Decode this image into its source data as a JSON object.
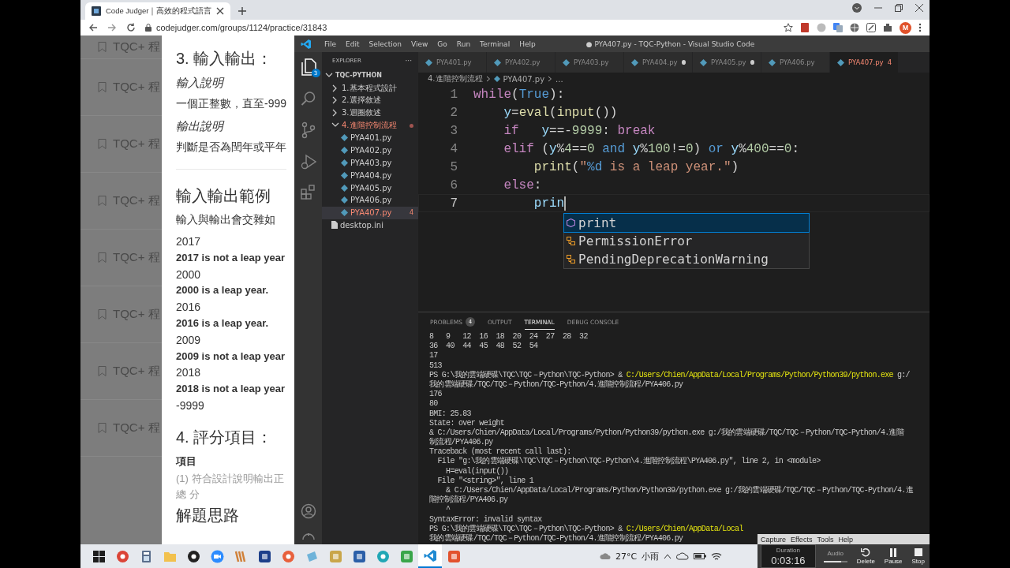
{
  "browser": {
    "tab": {
      "title": "Code Judger｜高效的程式語言"
    },
    "url": "codejudger.com/groups/1124/practice/31843",
    "profile_initial": "M"
  },
  "webpage": {
    "list_items": [
      "TQC+ 程",
      "TQC+ 程",
      "TQC+ 程",
      "TQC+ 程",
      "TQC+ 程",
      "TQC+ 程",
      "TQC+ 程",
      "TQC+ 程"
    ],
    "content": [
      {
        "kind": "heading",
        "text": "3. 輸入輸出："
      },
      {
        "kind": "subheading",
        "text": "輸入說明"
      },
      {
        "kind": "para",
        "text": "一個正整數，直至-999"
      },
      {
        "kind": "subheading",
        "text": "輸出說明"
      },
      {
        "kind": "para",
        "text": "判斷是否為閏年或平年"
      },
      {
        "kind": "divider"
      },
      {
        "kind": "heading",
        "text": "輸入輸出範例"
      },
      {
        "kind": "para",
        "text": "輸入與輸出會交雜如"
      },
      {
        "kind": "input",
        "text": "2017"
      },
      {
        "kind": "output",
        "text": "2017 is not a leap year"
      },
      {
        "kind": "input",
        "text": "2000"
      },
      {
        "kind": "output",
        "text": "2000 is a leap year."
      },
      {
        "kind": "input",
        "text": "2016"
      },
      {
        "kind": "output",
        "text": "2016 is a leap year."
      },
      {
        "kind": "input",
        "text": "2009"
      },
      {
        "kind": "output",
        "text": "2009 is not a leap year"
      },
      {
        "kind": "input",
        "text": "2018"
      },
      {
        "kind": "output",
        "text": "2018 is not a leap year"
      },
      {
        "kind": "input",
        "text": "-9999"
      },
      {
        "kind": "heading",
        "text": "4. 評分項目："
      },
      {
        "kind": "label",
        "text": "項目"
      },
      {
        "kind": "note",
        "text": "(1) 符合設計說明輸出正"
      },
      {
        "kind": "note",
        "text": "總 分"
      },
      {
        "kind": "heading",
        "text": "解題思路"
      }
    ]
  },
  "vscode": {
    "title": "● PYA407.py - TQC-Python - Visual Studio Code",
    "menu": [
      "File",
      "Edit",
      "Selection",
      "View",
      "Go",
      "Run",
      "Terminal",
      "Help"
    ],
    "explorer_badge": "3",
    "explorer_title": "EXPLORER",
    "explorer_more": "···",
    "tree": [
      {
        "label": "TQC-PYTHON",
        "kind": "root",
        "expanded": true,
        "error": false,
        "children": [
          {
            "label": "1.基本程式設計",
            "kind": "folder",
            "expanded": false,
            "error": false
          },
          {
            "label": "2.選擇敘述",
            "kind": "folder",
            "expanded": false,
            "error": false
          },
          {
            "label": "3.迴圈敘述",
            "kind": "folder",
            "expanded": false,
            "error": false
          },
          {
            "label": "4.進階控制流程",
            "kind": "folder",
            "expanded": true,
            "error": true,
            "children": [
              {
                "label": "PYA401.py",
                "kind": "python",
                "selected": false,
                "error": false
              },
              {
                "label": "PYA402.py",
                "kind": "python",
                "selected": false,
                "error": false
              },
              {
                "label": "PYA403.py",
                "kind": "python",
                "selected": false,
                "error": false
              },
              {
                "label": "PYA404.py",
                "kind": "python",
                "selected": false,
                "error": false
              },
              {
                "label": "PYA405.py",
                "kind": "python",
                "selected": false,
                "error": false
              },
              {
                "label": "PYA406.py",
                "kind": "python",
                "selected": false,
                "error": false
              },
              {
                "label": "PYA407.py",
                "kind": "python",
                "selected": true,
                "error": true,
                "problems": "4"
              }
            ]
          },
          {
            "label": "desktop.ini",
            "kind": "file",
            "selected": false,
            "error": false
          }
        ]
      }
    ],
    "tabs": [
      {
        "label": "PYA401.py",
        "selected": false,
        "dirty": false,
        "error": false
      },
      {
        "label": "PYA402.py",
        "selected": false,
        "dirty": false,
        "error": false
      },
      {
        "label": "PYA403.py",
        "selected": false,
        "dirty": false,
        "error": false
      },
      {
        "label": "PYA404.py",
        "selected": false,
        "dirty": true,
        "error": false
      },
      {
        "label": "PYA405.py",
        "selected": false,
        "dirty": true,
        "error": false
      },
      {
        "label": "PYA406.py",
        "selected": false,
        "dirty": false,
        "error": false
      },
      {
        "label": "PYA407.py",
        "selected": true,
        "dirty": true,
        "error": true,
        "problems": "4"
      }
    ],
    "breadcrumb": [
      "4.進階控制流程",
      "PYA407.py",
      "..."
    ],
    "code": [
      {
        "number": "1",
        "cursor": false,
        "tokens": [
          {
            "kind": "kw",
            "text": "while"
          },
          {
            "kind": "p",
            "text": "("
          },
          {
            "kind": "const",
            "text": "True"
          },
          {
            "kind": "p",
            "text": "):"
          }
        ]
      },
      {
        "number": "2",
        "cursor": false,
        "tokens": [
          {
            "kind": "var",
            "text": "    y"
          },
          {
            "kind": "p",
            "text": "="
          },
          {
            "kind": "fn",
            "text": "eval"
          },
          {
            "kind": "p",
            "text": "("
          },
          {
            "kind": "fn",
            "text": "input"
          },
          {
            "kind": "p",
            "text": "())"
          }
        ]
      },
      {
        "number": "3",
        "cursor": false,
        "tokens": [
          {
            "kind": "kw",
            "text": "    if   "
          },
          {
            "kind": "var",
            "text": "y"
          },
          {
            "kind": "p",
            "text": "==-"
          },
          {
            "kind": "num",
            "text": "9999"
          },
          {
            "kind": "p",
            "text": ": "
          },
          {
            "kind": "kw",
            "text": "break"
          }
        ]
      },
      {
        "number": "4",
        "cursor": false,
        "tokens": [
          {
            "kind": "kw",
            "text": "    elif"
          },
          {
            "kind": "p",
            "text": " ("
          },
          {
            "kind": "var",
            "text": "y"
          },
          {
            "kind": "p",
            "text": "%"
          },
          {
            "kind": "num",
            "text": "4"
          },
          {
            "kind": "p",
            "text": "=="
          },
          {
            "kind": "num",
            "text": "0"
          },
          {
            "kind": "const",
            "text": " and "
          },
          {
            "kind": "var",
            "text": "y"
          },
          {
            "kind": "p",
            "text": "%"
          },
          {
            "kind": "num",
            "text": "100"
          },
          {
            "kind": "p",
            "text": "!="
          },
          {
            "kind": "num",
            "text": "0"
          },
          {
            "kind": "p",
            "text": ") "
          },
          {
            "kind": "const",
            "text": "or "
          },
          {
            "kind": "var",
            "text": "y"
          },
          {
            "kind": "p",
            "text": "%"
          },
          {
            "kind": "num",
            "text": "400"
          },
          {
            "kind": "p",
            "text": "=="
          },
          {
            "kind": "num",
            "text": "0"
          },
          {
            "kind": "p",
            "text": ":"
          }
        ]
      },
      {
        "number": "5",
        "cursor": false,
        "tokens": [
          {
            "kind": "fn",
            "text": "        print"
          },
          {
            "kind": "p",
            "text": "("
          },
          {
            "kind": "str",
            "text": "\""
          },
          {
            "kind": "const",
            "text": "%d"
          },
          {
            "kind": "str",
            "text": " is a leap year.\""
          },
          {
            "kind": "p",
            "text": ")"
          }
        ]
      },
      {
        "number": "6",
        "cursor": false,
        "tokens": [
          {
            "kind": "kw",
            "text": "    else"
          },
          {
            "kind": "p",
            "text": ":"
          }
        ]
      },
      {
        "number": "7",
        "cursor": true,
        "tokens": [
          {
            "kind": "var",
            "text": "        prin"
          }
        ]
      }
    ],
    "suggestions": [
      {
        "label": "print",
        "kind": "function",
        "selected": true
      },
      {
        "label": "PermissionError",
        "kind": "class",
        "selected": false
      },
      {
        "label": "PendingDeprecationWarning",
        "kind": "class",
        "selected": false
      }
    ],
    "panel_tabs": [
      {
        "label": "PROBLEMS",
        "count": "4",
        "selected": false
      },
      {
        "label": "OUTPUT",
        "selected": false
      },
      {
        "label": "TERMINAL",
        "selected": true
      },
      {
        "label": "DEBUG CONSOLE",
        "selected": false
      }
    ],
    "terminal": [
      [
        {
          "kind": "plain",
          "text": "8   9   12  16  18  20  24  27  28  32"
        }
      ],
      [
        {
          "kind": "plain",
          "text": "36  40  44  45  48  52  54"
        }
      ],
      [
        {
          "kind": "plain",
          "text": "17"
        }
      ],
      [
        {
          "kind": "plain",
          "text": "513"
        }
      ],
      [
        {
          "kind": "plain",
          "text": "PS G:\\我的雲端硬碟\\TQC\\TQC－Python\\TQC-Python> & "
        },
        {
          "kind": "command",
          "text": "C:/Users/Chien/AppData/Local/Programs/Python/Python39/python.exe"
        },
        {
          "kind": "plain",
          "text": " g:/"
        }
      ],
      [
        {
          "kind": "plain",
          "text": "我的雲端硬碟/TQC/TQC－Python/TQC-Python/4.進階控制流程/PYA406.py"
        }
      ],
      [
        {
          "kind": "plain",
          "text": "176"
        }
      ],
      [
        {
          "kind": "plain",
          "text": "80"
        }
      ],
      [
        {
          "kind": "plain",
          "text": "BMI: 25.83"
        }
      ],
      [
        {
          "kind": "plain",
          "text": "State: over weight"
        }
      ],
      [
        {
          "kind": "plain",
          "text": "& C:/Users/Chien/AppData/Local/Programs/Python/Python39/python.exe g:/我的雲端硬碟/TQC/TQC－Python/TQC-Python/4.進階"
        }
      ],
      [
        {
          "kind": "plain",
          "text": "制流程/PYA406.py"
        }
      ],
      [
        {
          "kind": "plain",
          "text": "Traceback (most recent call last):"
        }
      ],
      [
        {
          "kind": "plain",
          "text": "  File \"g:\\我的雲端硬碟\\TQC\\TQC－Python\\TQC-Python\\4.進階控制流程\\PYA406.py\", line 2, in <module>"
        }
      ],
      [
        {
          "kind": "plain",
          "text": "    H=eval(input())"
        }
      ],
      [
        {
          "kind": "plain",
          "text": "  File \"<string>\", line 1"
        }
      ],
      [
        {
          "kind": "plain",
          "text": "    & C:/Users/Chien/AppData/Local/Programs/Python/Python39/python.exe g:/我的雲端硬碟/TQC/TQC－Python/TQC-Python/4.進"
        }
      ],
      [
        {
          "kind": "plain",
          "text": "階控制流程/PYA406.py"
        }
      ],
      [
        {
          "kind": "plain",
          "text": "    ^"
        }
      ],
      [
        {
          "kind": "plain",
          "text": "SyntaxError: invalid syntax"
        }
      ],
      [
        {
          "kind": "plain",
          "text": "PS G:\\我的雲端硬碟\\TQC\\TQC－Python\\TQC-Python> & "
        },
        {
          "kind": "command",
          "text": "C:/Users/Chien/AppData/Local"
        }
      ],
      [
        {
          "kind": "plain",
          "text": "我的雲端硬碟/TQC/TQC－Python/TQC-Python/4.進階控制流程/PYA406.py"
        }
      ]
    ]
  },
  "taskbar": {
    "apps": [
      {
        "kind": "windows",
        "active": false,
        "color": "#1e1e1e"
      },
      {
        "kind": "ring",
        "active": false,
        "color": "#db4437"
      },
      {
        "kind": "calculator",
        "active": false,
        "color": "#5a6e8c"
      },
      {
        "kind": "folder",
        "active": false,
        "color": "#f2c14e"
      },
      {
        "kind": "ring",
        "active": false,
        "color": "#222222"
      },
      {
        "kind": "camera",
        "active": false,
        "color": "#2d8cff"
      },
      {
        "kind": "stripes",
        "active": false,
        "color": "#d0813a"
      },
      {
        "kind": "square",
        "active": false,
        "color": "#1d3f8a"
      },
      {
        "kind": "ring",
        "active": false,
        "color": "#e8603c"
      },
      {
        "kind": "sheet",
        "active": false,
        "color": "#6fb3d9"
      },
      {
        "kind": "square",
        "active": false,
        "color": "#c9a64a"
      },
      {
        "kind": "square",
        "active": false,
        "color": "#2b5fa8"
      },
      {
        "kind": "ring",
        "active": false,
        "color": "#21a7b5"
      },
      {
        "kind": "square",
        "active": false,
        "color": "#3aa64a"
      },
      {
        "kind": "code",
        "active": true,
        "color": "#1f8ad2"
      },
      {
        "kind": "square",
        "active": false,
        "color": "#e2522e"
      }
    ],
    "weather": "27°C",
    "weather_desc": "小雨"
  },
  "recorder": {
    "menu": [
      "Capture",
      "Effects",
      "Tools",
      "Help"
    ],
    "duration_label": "Duration",
    "duration": "0:03:16",
    "audio": {
      "label": "Audio",
      "level": 0.75
    },
    "buttons": [
      {
        "label": "Delete",
        "kind": "delete"
      },
      {
        "label": "Pause",
        "kind": "pause"
      },
      {
        "label": "Stop",
        "kind": "stop"
      }
    ]
  }
}
